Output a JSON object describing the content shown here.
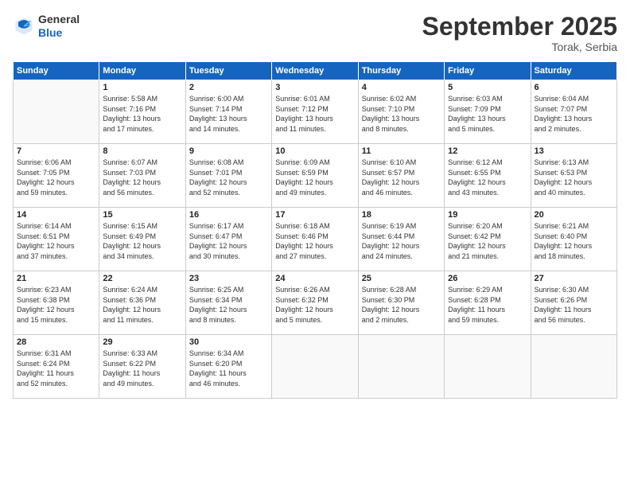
{
  "header": {
    "logo_general": "General",
    "logo_blue": "Blue",
    "month": "September 2025",
    "location": "Torak, Serbia"
  },
  "weekdays": [
    "Sunday",
    "Monday",
    "Tuesday",
    "Wednesday",
    "Thursday",
    "Friday",
    "Saturday"
  ],
  "weeks": [
    [
      {
        "day": "",
        "info": ""
      },
      {
        "day": "1",
        "info": "Sunrise: 5:58 AM\nSunset: 7:16 PM\nDaylight: 13 hours\nand 17 minutes."
      },
      {
        "day": "2",
        "info": "Sunrise: 6:00 AM\nSunset: 7:14 PM\nDaylight: 13 hours\nand 14 minutes."
      },
      {
        "day": "3",
        "info": "Sunrise: 6:01 AM\nSunset: 7:12 PM\nDaylight: 13 hours\nand 11 minutes."
      },
      {
        "day": "4",
        "info": "Sunrise: 6:02 AM\nSunset: 7:10 PM\nDaylight: 13 hours\nand 8 minutes."
      },
      {
        "day": "5",
        "info": "Sunrise: 6:03 AM\nSunset: 7:09 PM\nDaylight: 13 hours\nand 5 minutes."
      },
      {
        "day": "6",
        "info": "Sunrise: 6:04 AM\nSunset: 7:07 PM\nDaylight: 13 hours\nand 2 minutes."
      }
    ],
    [
      {
        "day": "7",
        "info": "Sunrise: 6:06 AM\nSunset: 7:05 PM\nDaylight: 12 hours\nand 59 minutes."
      },
      {
        "day": "8",
        "info": "Sunrise: 6:07 AM\nSunset: 7:03 PM\nDaylight: 12 hours\nand 56 minutes."
      },
      {
        "day": "9",
        "info": "Sunrise: 6:08 AM\nSunset: 7:01 PM\nDaylight: 12 hours\nand 52 minutes."
      },
      {
        "day": "10",
        "info": "Sunrise: 6:09 AM\nSunset: 6:59 PM\nDaylight: 12 hours\nand 49 minutes."
      },
      {
        "day": "11",
        "info": "Sunrise: 6:10 AM\nSunset: 6:57 PM\nDaylight: 12 hours\nand 46 minutes."
      },
      {
        "day": "12",
        "info": "Sunrise: 6:12 AM\nSunset: 6:55 PM\nDaylight: 12 hours\nand 43 minutes."
      },
      {
        "day": "13",
        "info": "Sunrise: 6:13 AM\nSunset: 6:53 PM\nDaylight: 12 hours\nand 40 minutes."
      }
    ],
    [
      {
        "day": "14",
        "info": "Sunrise: 6:14 AM\nSunset: 6:51 PM\nDaylight: 12 hours\nand 37 minutes."
      },
      {
        "day": "15",
        "info": "Sunrise: 6:15 AM\nSunset: 6:49 PM\nDaylight: 12 hours\nand 34 minutes."
      },
      {
        "day": "16",
        "info": "Sunrise: 6:17 AM\nSunset: 6:47 PM\nDaylight: 12 hours\nand 30 minutes."
      },
      {
        "day": "17",
        "info": "Sunrise: 6:18 AM\nSunset: 6:46 PM\nDaylight: 12 hours\nand 27 minutes."
      },
      {
        "day": "18",
        "info": "Sunrise: 6:19 AM\nSunset: 6:44 PM\nDaylight: 12 hours\nand 24 minutes."
      },
      {
        "day": "19",
        "info": "Sunrise: 6:20 AM\nSunset: 6:42 PM\nDaylight: 12 hours\nand 21 minutes."
      },
      {
        "day": "20",
        "info": "Sunrise: 6:21 AM\nSunset: 6:40 PM\nDaylight: 12 hours\nand 18 minutes."
      }
    ],
    [
      {
        "day": "21",
        "info": "Sunrise: 6:23 AM\nSunset: 6:38 PM\nDaylight: 12 hours\nand 15 minutes."
      },
      {
        "day": "22",
        "info": "Sunrise: 6:24 AM\nSunset: 6:36 PM\nDaylight: 12 hours\nand 11 minutes."
      },
      {
        "day": "23",
        "info": "Sunrise: 6:25 AM\nSunset: 6:34 PM\nDaylight: 12 hours\nand 8 minutes."
      },
      {
        "day": "24",
        "info": "Sunrise: 6:26 AM\nSunset: 6:32 PM\nDaylight: 12 hours\nand 5 minutes."
      },
      {
        "day": "25",
        "info": "Sunrise: 6:28 AM\nSunset: 6:30 PM\nDaylight: 12 hours\nand 2 minutes."
      },
      {
        "day": "26",
        "info": "Sunrise: 6:29 AM\nSunset: 6:28 PM\nDaylight: 11 hours\nand 59 minutes."
      },
      {
        "day": "27",
        "info": "Sunrise: 6:30 AM\nSunset: 6:26 PM\nDaylight: 11 hours\nand 56 minutes."
      }
    ],
    [
      {
        "day": "28",
        "info": "Sunrise: 6:31 AM\nSunset: 6:24 PM\nDaylight: 11 hours\nand 52 minutes."
      },
      {
        "day": "29",
        "info": "Sunrise: 6:33 AM\nSunset: 6:22 PM\nDaylight: 11 hours\nand 49 minutes."
      },
      {
        "day": "30",
        "info": "Sunrise: 6:34 AM\nSunset: 6:20 PM\nDaylight: 11 hours\nand 46 minutes."
      },
      {
        "day": "",
        "info": ""
      },
      {
        "day": "",
        "info": ""
      },
      {
        "day": "",
        "info": ""
      },
      {
        "day": "",
        "info": ""
      }
    ]
  ]
}
